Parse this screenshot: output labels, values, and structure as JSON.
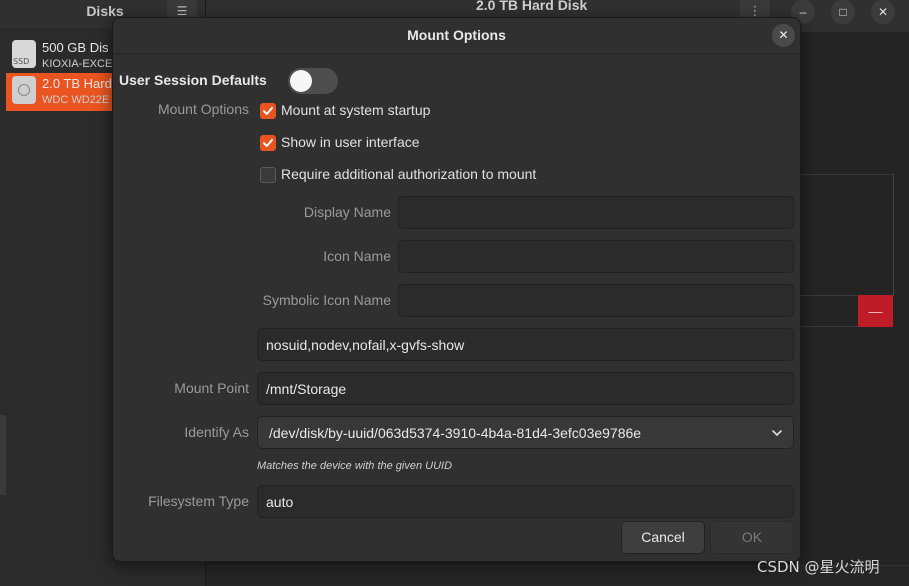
{
  "background": {
    "sidebar": {
      "title": "Disks",
      "disks": [
        {
          "name": "500 GB Dis",
          "model": "KIOXIA-EXCE",
          "icon": "ssd-icon",
          "icon_text": "SSD"
        },
        {
          "name": "2.0 TB Hard",
          "model": "WDC WD22E",
          "icon": "hard-disk-icon",
          "selected": true
        }
      ]
    },
    "header": {
      "title": "2.0 TB Hard Disk"
    },
    "window_buttons": [
      "minimize",
      "maximize",
      "close"
    ],
    "delete_button": "—"
  },
  "dialog": {
    "title": "Mount Options",
    "user_session_defaults": {
      "label": "User Session Defaults",
      "enabled": false
    },
    "mount_options": {
      "label": "Mount Options",
      "checks": [
        {
          "label": "Mount at system startup",
          "checked": true
        },
        {
          "label": "Show in user interface",
          "checked": true
        },
        {
          "label": "Require additional authorization to mount",
          "checked": false
        }
      ]
    },
    "display_name": {
      "label": "Display Name",
      "value": ""
    },
    "icon_name": {
      "label": "Icon Name",
      "value": ""
    },
    "symbolic_icon_name": {
      "label": "Symbolic Icon Name",
      "value": ""
    },
    "options_string": {
      "value": "nosuid,nodev,nofail,x-gvfs-show"
    },
    "mount_point": {
      "label": "Mount Point",
      "value": "/mnt/Storage"
    },
    "identify_as": {
      "label": "Identify As",
      "value": "/dev/disk/by-uuid/063d5374-3910-4b4a-81d4-3efc03e9786e",
      "hint": "Matches the device with the given UUID"
    },
    "filesystem_type": {
      "label": "Filesystem Type",
      "value": "auto"
    },
    "buttons": {
      "cancel": "Cancel",
      "ok": "OK"
    }
  },
  "watermark": "CSDN @星火流明",
  "colors": {
    "accent": "#e95420",
    "destructive": "#c01c28",
    "dialog_bg": "#303030"
  }
}
